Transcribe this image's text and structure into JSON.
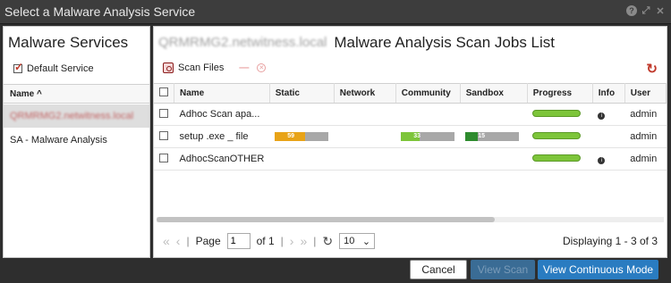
{
  "window": {
    "title": "Select a Malware Analysis Service"
  },
  "services": {
    "title": "Malware Services",
    "default_service_label": "Default Service",
    "name_header": "Name ^",
    "items": [
      {
        "label": "QRMRMG2.netwitness.local"
      },
      {
        "label": "SA - Malware Analysis"
      }
    ]
  },
  "jobs": {
    "host_label": "QRMRMG2.netwitness.local",
    "title": "Malware Analysis Scan Jobs List",
    "scan_files_label": "Scan Files",
    "columns": [
      "Name",
      "Static",
      "Network",
      "Community",
      "Sandbox",
      "Progress",
      "Info",
      "User"
    ],
    "rows": [
      {
        "name": "Adhoc Scan apa...",
        "static": null,
        "community": null,
        "sandbox": null,
        "info": true,
        "user": "admin"
      },
      {
        "name": "setup .exe _ file",
        "static": {
          "value": "59",
          "fraction": 0.57,
          "color": "#e8a317"
        },
        "community": {
          "value": "33",
          "fraction": 0.35,
          "color": "#7dc53a"
        },
        "sandbox": {
          "value": "15",
          "fraction": 0.17,
          "color": "#2e8b2e"
        },
        "info": false,
        "user": "admin"
      },
      {
        "name": "AdhocScanOTHER",
        "static": null,
        "community": null,
        "sandbox": null,
        "info": true,
        "user": "admin"
      }
    ],
    "pager": {
      "page_label": "Page",
      "page_value": "1",
      "of_label": "of 1",
      "page_size": "10",
      "display_text": "Displaying 1 - 3 of 3"
    }
  },
  "footer": {
    "cancel_label": "Cancel",
    "view_scan_label": "View Scan",
    "view_continuous_label": "View Continuous Mode"
  }
}
